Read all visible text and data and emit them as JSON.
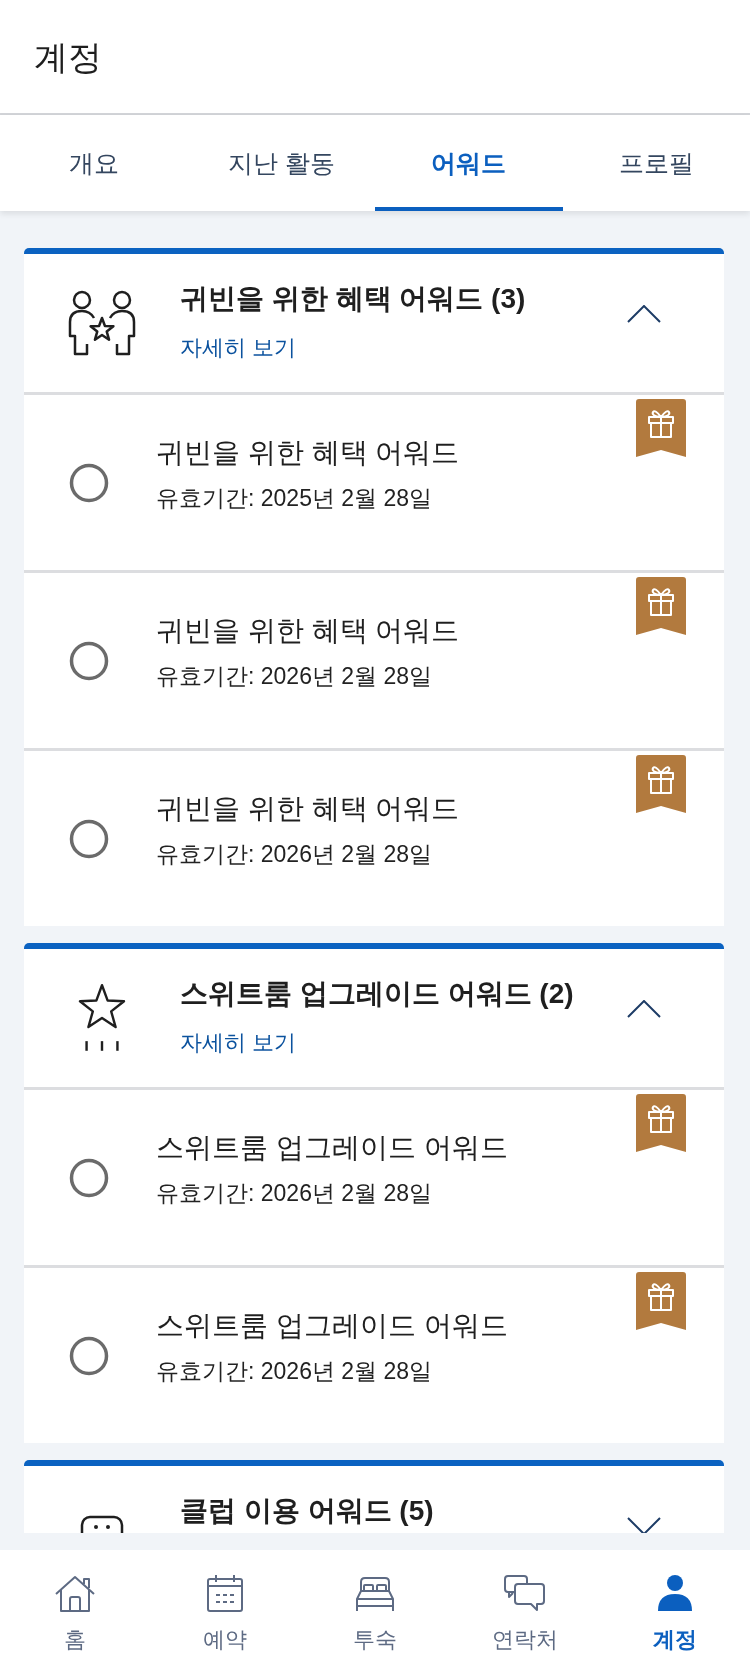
{
  "header": {
    "title": "계정"
  },
  "tabs": [
    {
      "label": "개요",
      "selected": false
    },
    {
      "label": "지난 활동",
      "selected": false
    },
    {
      "label": "어워드",
      "selected": true
    },
    {
      "label": "프로필",
      "selected": false
    }
  ],
  "sections": [
    {
      "kind": "guests",
      "title": "귀빈을 위한 혜택 어워드 (3)",
      "link": "자세히 보기",
      "expanded": true,
      "awards": [
        {
          "title": "귀빈을 위한 혜택 어워드",
          "expiry": "유효기간: 2025년 2월 28일",
          "selected": false
        },
        {
          "title": "귀빈을 위한 혜택 어워드",
          "expiry": "유효기간: 2026년 2월 28일",
          "selected": false
        },
        {
          "title": "귀빈을 위한 혜택 어워드",
          "expiry": "유효기간: 2026년 2월 28일",
          "selected": false
        }
      ]
    },
    {
      "kind": "upgrade",
      "title": "스위트룸 업그레이드 어워드 (2)",
      "link": "자세히 보기",
      "expanded": true,
      "awards": [
        {
          "title": "스위트룸 업그레이드 어워드",
          "expiry": "유효기간: 2026년 2월 28일",
          "selected": false
        },
        {
          "title": "스위트룸 업그레이드 어워드",
          "expiry": "유효기간: 2026년 2월 28일",
          "selected": false
        }
      ]
    },
    {
      "kind": "club",
      "title": "클럽 이용 어워드 (5)",
      "expanded": false
    }
  ],
  "bottom_nav": [
    {
      "kind": "home",
      "label": "홈",
      "selected": false
    },
    {
      "kind": "calendar",
      "label": "예약",
      "selected": false
    },
    {
      "kind": "bed",
      "label": "투숙",
      "selected": false
    },
    {
      "kind": "chat",
      "label": "연락처",
      "selected": false
    },
    {
      "kind": "person",
      "label": "계정",
      "selected": true
    }
  ]
}
